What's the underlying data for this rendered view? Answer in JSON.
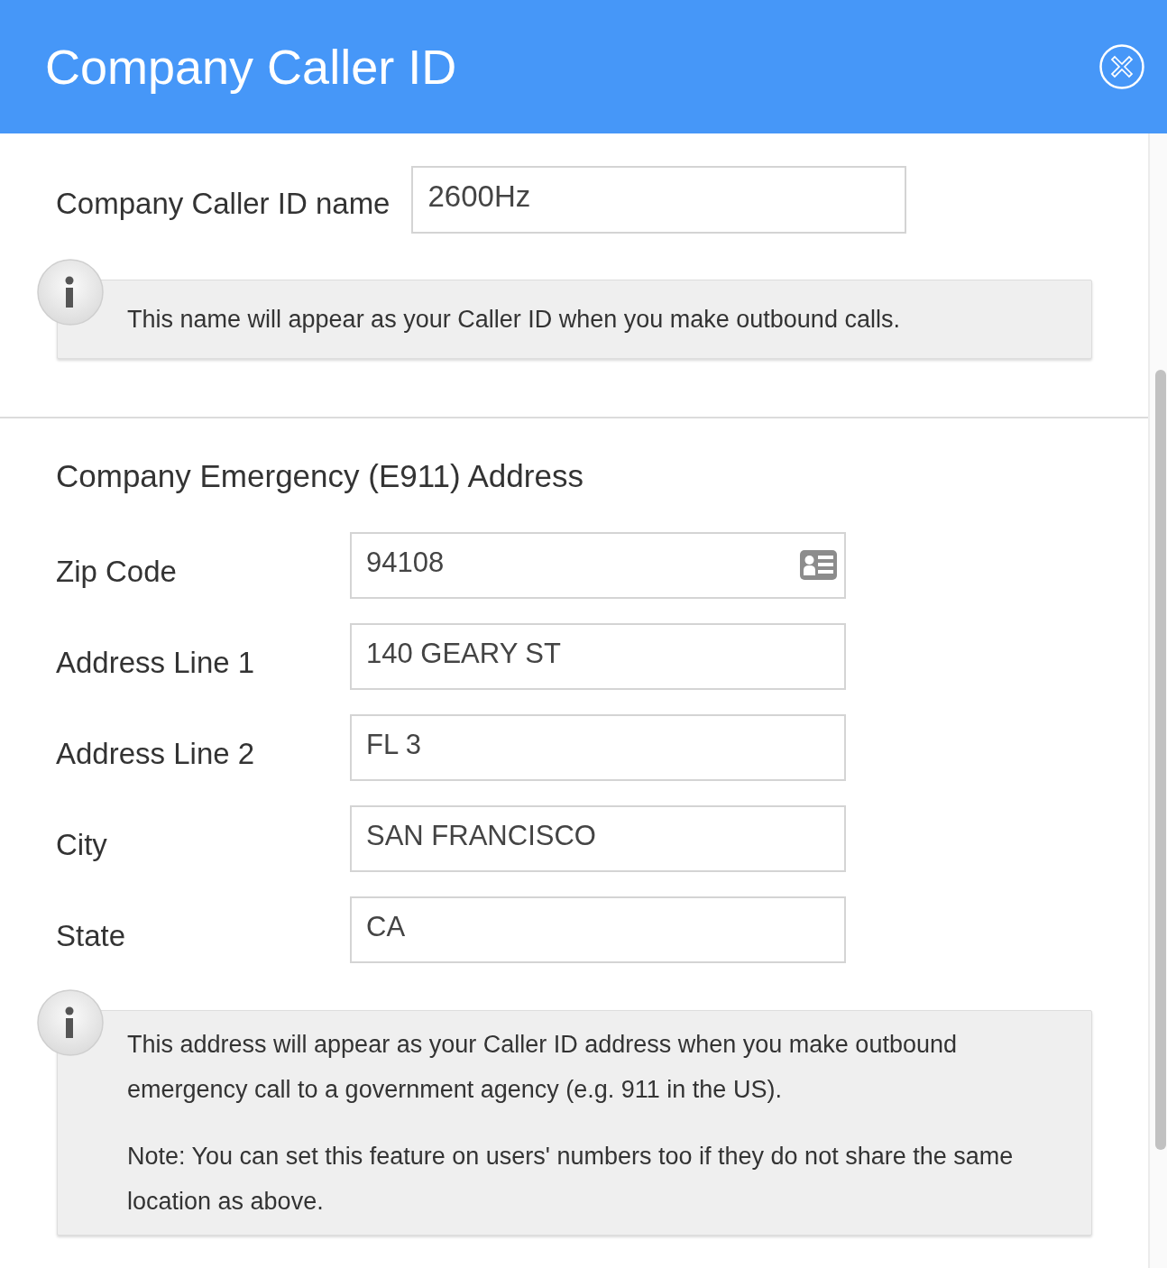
{
  "dialog": {
    "title": "Company Caller ID"
  },
  "caller_id": {
    "label": "Company Caller ID name",
    "value": "2600Hz",
    "info": [
      "This name will appear as your Caller ID when you make outbound calls."
    ]
  },
  "emergency": {
    "heading": "Company Emergency (E911) Address",
    "fields": [
      {
        "label": "Zip Code",
        "value": "94108",
        "kind": "lookup"
      },
      {
        "label": "Address Line 1",
        "value": "140 GEARY ST",
        "kind": "text"
      },
      {
        "label": "Address Line 2",
        "value": "FL 3",
        "kind": "text"
      },
      {
        "label": "City",
        "value": "SAN FRANCISCO",
        "kind": "text"
      },
      {
        "label": "State",
        "value": "CA",
        "kind": "text"
      }
    ],
    "info": [
      "This address will appear as your Caller ID address when you make outbound emergency call to a government agency (e.g. 911 in the US).",
      "Note: You can set this feature on users' numbers too if they do not share the same location as above."
    ]
  }
}
